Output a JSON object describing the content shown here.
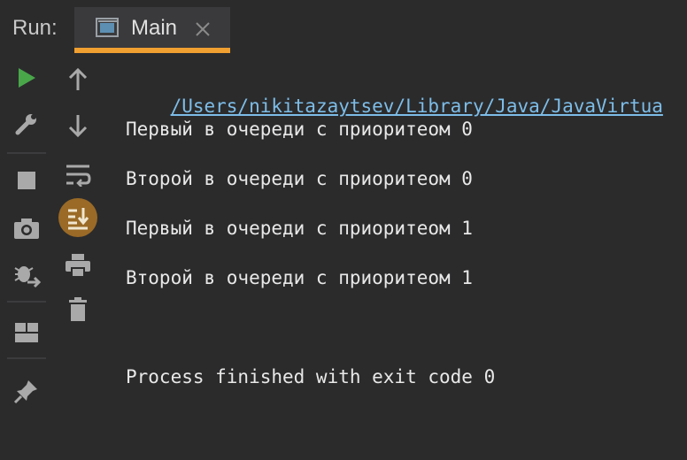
{
  "tabbar": {
    "run_label": "Run:",
    "tab_title": "Main",
    "tab_icon": "window-icon",
    "close_icon": "close-icon"
  },
  "left_toolbar": [
    {
      "name": "rerun-icon",
      "color": "#49a74a"
    },
    {
      "name": "wrench-icon"
    },
    {
      "name": "stop-icon"
    },
    {
      "name": "camera-icon"
    },
    {
      "name": "debug-exit-icon"
    },
    {
      "name": "layout-icon"
    },
    {
      "name": "pin-icon"
    }
  ],
  "second_toolbar": [
    {
      "name": "up-arrow-icon"
    },
    {
      "name": "down-arrow-icon"
    },
    {
      "name": "soft-wrap-icon"
    },
    {
      "name": "scroll-to-end-icon",
      "color": "#9a6a26"
    },
    {
      "name": "print-icon"
    },
    {
      "name": "trash-icon"
    }
  ],
  "console": {
    "path": "/Users/nikitazaytsev/Library/Java/JavaVirtua",
    "lines": [
      "Первый в очереди с приоритеом 0",
      "Второй в очереди с приоритеом 0",
      "Первый в очереди с приоритеом 1",
      "Второй в очереди с приоритеом 1"
    ],
    "exit_message": "Process finished with exit code 0"
  },
  "colors": {
    "background": "#2b2b2c",
    "tab_accent": "#f0a030",
    "link": "#7dbde8",
    "run_green": "#49a74a"
  }
}
